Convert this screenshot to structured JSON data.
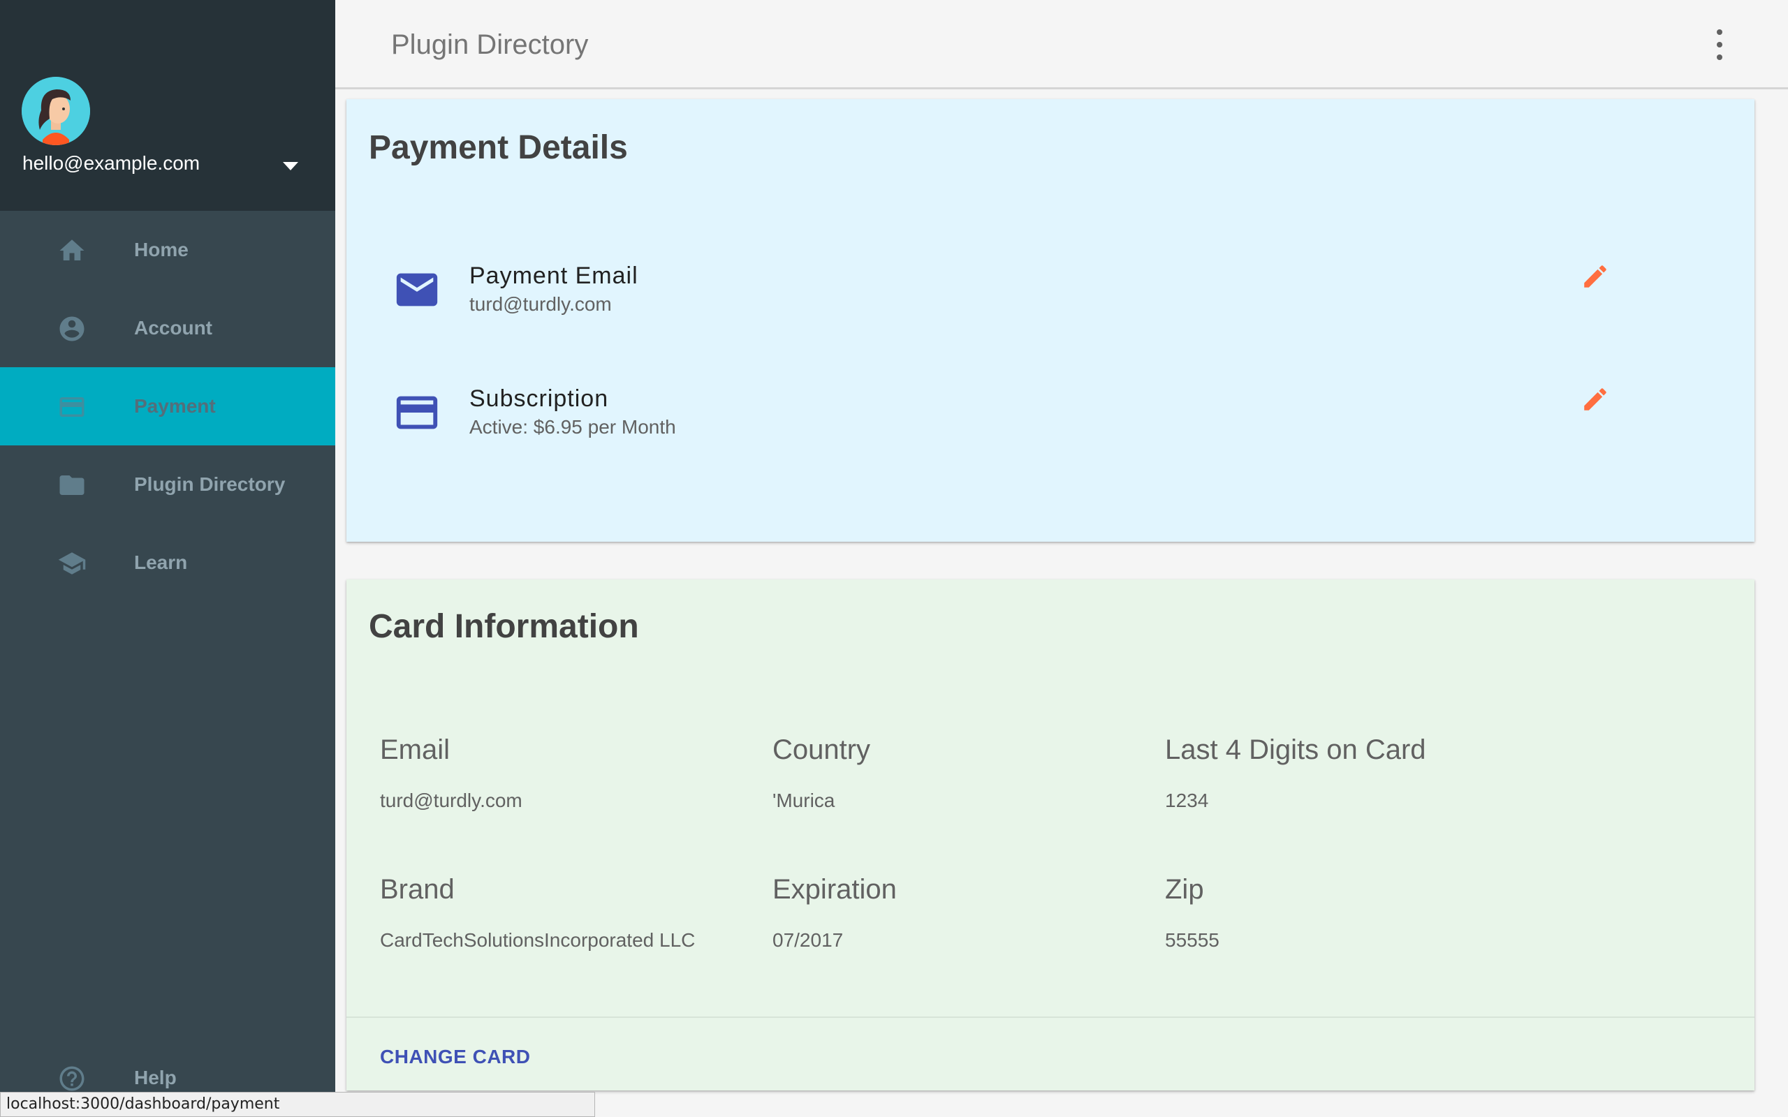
{
  "sidebar": {
    "user_email": "hello@example.com",
    "nav_items": [
      {
        "label": "Home",
        "icon": "home-icon",
        "active": false
      },
      {
        "label": "Account",
        "icon": "account-circle-icon",
        "active": false
      },
      {
        "label": "Payment",
        "icon": "credit-card-icon",
        "active": true
      },
      {
        "label": "Plugin Directory",
        "icon": "folder-icon",
        "active": false
      },
      {
        "label": "Learn",
        "icon": "school-icon",
        "active": false
      }
    ],
    "help_label": "Help"
  },
  "topbar": {
    "title": "Plugin Directory"
  },
  "payment_details": {
    "title": "Payment Details",
    "rows": [
      {
        "title": "Payment Email",
        "value": "turd@turdly.com",
        "icon": "email-icon"
      },
      {
        "title": "Subscription",
        "value": "Active: $6.95 per Month",
        "icon": "credit-card-icon"
      }
    ]
  },
  "card_information": {
    "title": "Card Information",
    "fields": [
      {
        "label": "Email",
        "value": "turd@turdly.com"
      },
      {
        "label": "Country",
        "value": "'Murica"
      },
      {
        "label": "Last 4 Digits on Card",
        "value": "1234"
      },
      {
        "label": "Brand",
        "value": "CardTechSolutionsIncorporated LLC"
      },
      {
        "label": "Expiration",
        "value": "07/2017"
      },
      {
        "label": "Zip",
        "value": "55555"
      }
    ],
    "action_label": "CHANGE CARD"
  },
  "status_bar": {
    "url": "localhost:3000/dashboard/payment"
  },
  "colors": {
    "sidebar_bg": "#37474f",
    "sidebar_header_bg": "#263238",
    "active_nav": "#00acc1",
    "payment_card_bg": "#e1f5fe",
    "card_info_bg": "#e8f5e9",
    "accent_blue": "#3f51b5",
    "edit_orange": "#ff6e40"
  }
}
